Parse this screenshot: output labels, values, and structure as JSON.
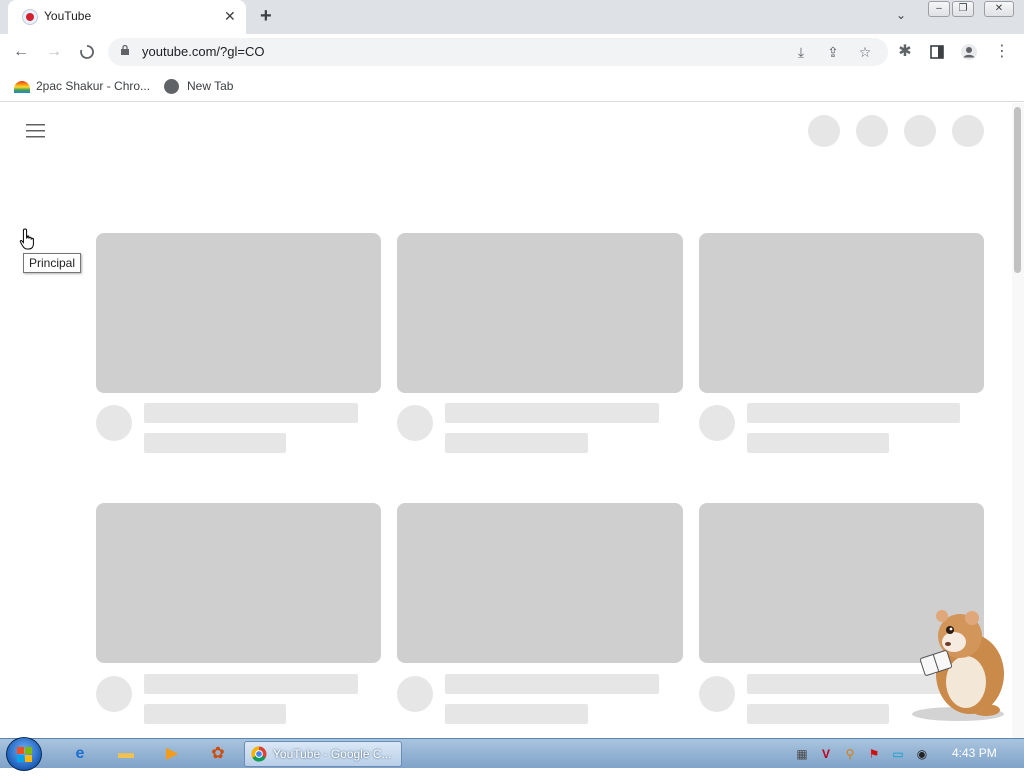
{
  "browser": {
    "tab_title": "YouTube",
    "tab_close": "✕",
    "new_tab": "+",
    "tab_search": "⌄",
    "url": "youtube.com/?gl=CO",
    "bookmarks": [
      {
        "label": "2pac Shakur - Chro..."
      },
      {
        "label": "New Tab"
      }
    ]
  },
  "page": {
    "tooltip": "Principal"
  },
  "taskbar": {
    "chrome_task_label": "YouTube - Google C...",
    "clock": "4:43 PM"
  },
  "colors": {
    "skeleton_block": "#cfcfcf",
    "skeleton_line": "#e6e6e6",
    "tab_strip": "#dee1e6",
    "omnibox": "#f1f3f4"
  }
}
